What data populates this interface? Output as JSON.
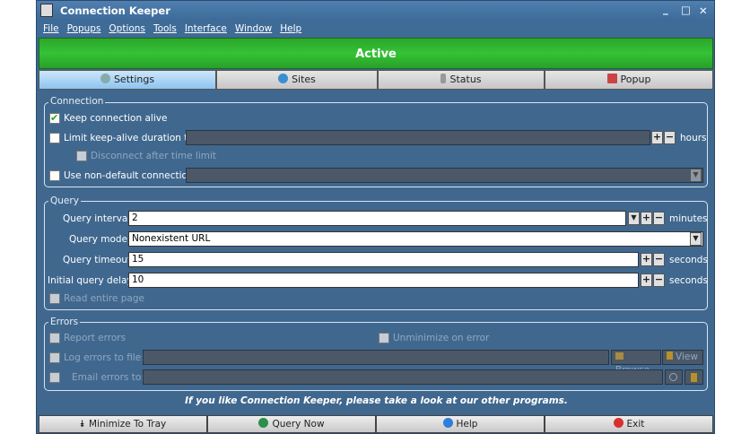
{
  "window": {
    "title": "Connection Keeper",
    "controls": [
      "_",
      "□",
      "✕"
    ]
  },
  "menu": [
    "File",
    "Popups",
    "Options",
    "Tools",
    "Interface",
    "Window",
    "Help"
  ],
  "status": "Active",
  "tabs": [
    "Settings",
    "Sites",
    "Status",
    "Popup"
  ],
  "connection": {
    "group": "Connection",
    "keep_alive": "Keep connection alive",
    "limit": "Limit keep-alive duration to:",
    "hours": "hours",
    "disconnect": "Disconnect after time limit",
    "non_default": "Use non-default connection:"
  },
  "query": {
    "group": "Query",
    "interval_label": "Query interval:",
    "interval": "2",
    "minutes": "minutes",
    "mode_label": "Query mode:",
    "mode": "Nonexistent URL",
    "timeout_label": "Query timeout:",
    "timeout": "15",
    "seconds": "seconds",
    "delay_label": "Initial query delay:",
    "delay": "10",
    "seconds2": "seconds",
    "read_entire": "Read entire page"
  },
  "errors": {
    "group": "Errors",
    "report": "Report errors",
    "unminimize": "Unminimize on error",
    "log": "Log errors to file:",
    "browse": "Browse",
    "view": "View",
    "email": "Email errors to:"
  },
  "footer": "If you like Connection Keeper, please take a look at our other programs.",
  "buttons": [
    "Minimize To Tray",
    "Query Now",
    "Help",
    "Exit"
  ]
}
